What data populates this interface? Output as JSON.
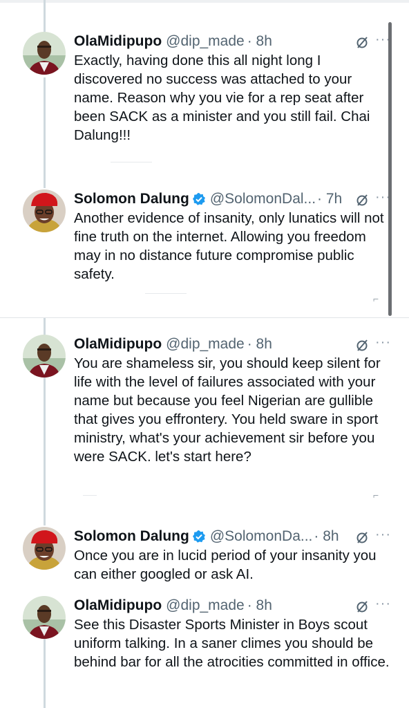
{
  "tweets": [
    {
      "name": "OlaMidipupo",
      "handle": "@dip_made",
      "time": "· 8h",
      "verified": false,
      "text": "Exactly, having done this all night long I discovered no success was attached to your name. Reason why you vie for a rep seat after been SACK as a minister and you still fail. Chai Dalung!!!"
    },
    {
      "name": "Solomon Dalung",
      "handle": "@SolomonDal...",
      "time": "· 7h",
      "verified": true,
      "text": "Another evidence of insanity, only lunatics will not fine truth on the internet. Allowing you freedom may in no distance future compromise public safety."
    },
    {
      "name": "OlaMidipupo",
      "handle": "@dip_made",
      "time": "· 8h",
      "verified": false,
      "text": "You are shameless sir, you should keep silent for life with the level of failures associated with your name but because you feel Nigerian are gullible that gives you effrontery. You held sware in sport ministry, what's your achievement sir before you were SACK. let's start here?"
    },
    {
      "name": "Solomon Dalung",
      "handle": "@SolomonDa...",
      "time": "· 8h",
      "verified": true,
      "text": "Once you are in lucid period of your insanity you can either googled or ask AI."
    },
    {
      "name": "OlaMidipupo",
      "handle": "@dip_made",
      "time": "· 8h",
      "verified": false,
      "text": "See this Disaster Sports Minister in Boys scout uniform talking. In a saner climes you should be behind bar for all the atrocities committed in office."
    }
  ],
  "ui": {
    "more_label": "···",
    "grok_icon": "grok-icon",
    "more_icon": "more-icon",
    "verified_icon": "verified-badge-icon",
    "verified_color": "#1d9bf0",
    "thread_line_color": "#cfd9de"
  }
}
